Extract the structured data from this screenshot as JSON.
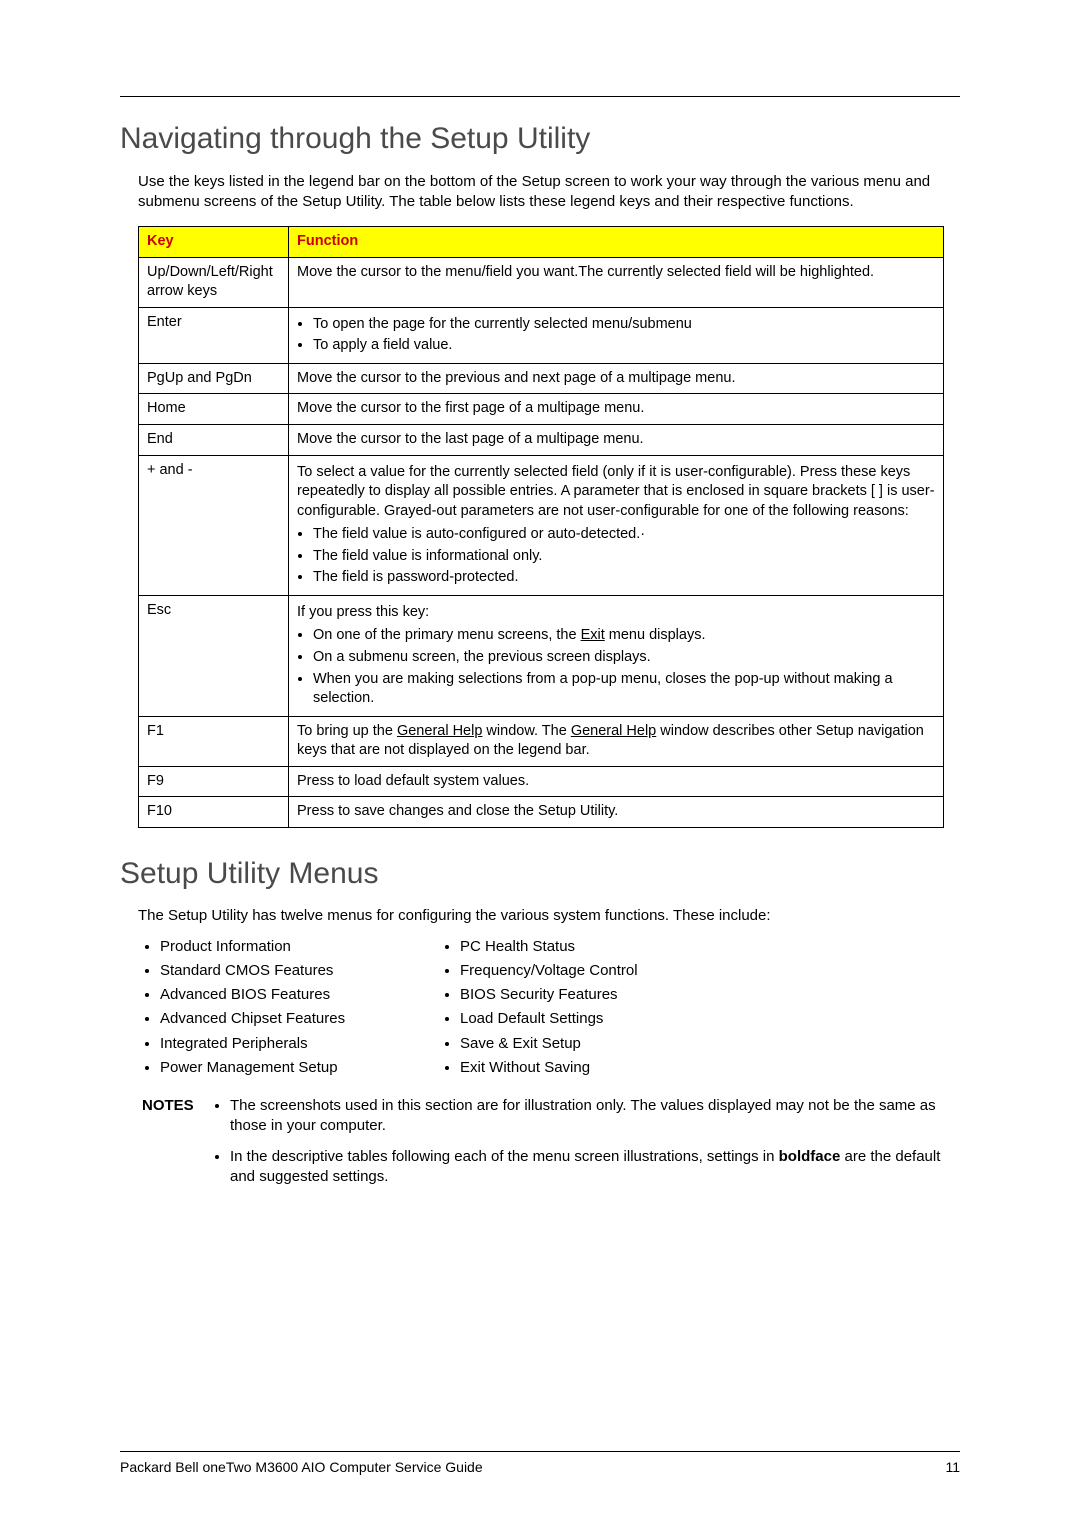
{
  "heading1": "Navigating through the Setup Utility",
  "intro1": "Use the keys listed in the legend bar on the bottom of the Setup screen to work your way through the various menu and submenu screens of the Setup Utility. The table below lists these legend keys and their respective functions.",
  "table": {
    "headers": [
      "Key",
      "Function"
    ],
    "rows": [
      {
        "key": "Up/Down/Left/Right arrow keys",
        "func_text": "Move the cursor to the menu/field you want.The currently selected field will be highlighted."
      },
      {
        "key": "Enter",
        "func_list": [
          "To open the page for the currently selected menu/submenu",
          "To apply a field value."
        ]
      },
      {
        "key": "PgUp and PgDn",
        "func_text": "Move the cursor to the previous and next page of a multipage menu."
      },
      {
        "key": "Home",
        "func_text": "Move the cursor to the first page of a multipage menu."
      },
      {
        "key": "End",
        "func_text": "Move the cursor to the last page of a multipage menu."
      },
      {
        "key": "+ and -",
        "func_para": "To select a value for the currently selected field (only if it is user-configurable). Press these keys repeatedly to display all possible entries. A parameter that is enclosed in square brackets [ ] is user-configurable. Grayed-out parameters are not user-configurable for one of the following reasons:",
        "func_list": [
          "The field value is auto-configured or auto-detected.·",
          "The field value is informational only.",
          "The field is password-protected."
        ]
      },
      {
        "key": "Esc",
        "func_intro": "If you press this key:",
        "esc1a": "On one of the primary menu screens, the ",
        "esc1b": "Exit",
        "esc1c": " menu displays.",
        "esc2": "On a submenu screen, the previous screen displays.",
        "esc3": "When you are making selections from a pop-up menu, closes the pop-up without making a selection."
      },
      {
        "key": "F1",
        "f1a": "To bring up the ",
        "f1b": "General Help",
        "f1c": " window. The ",
        "f1d": "General Help",
        "f1e": " window describes other Setup navigation keys that are not displayed on the legend bar."
      },
      {
        "key": "F9",
        "func_text": "Press to load default system values."
      },
      {
        "key": "F10",
        "func_text": "Press to save changes and close the Setup Utility."
      }
    ]
  },
  "heading2": "Setup Utility Menus",
  "menus_intro": "The Setup Utility has twelve menus for configuring the various system functions. These include:",
  "menus_left": [
    "Product Information",
    "Standard CMOS Features",
    "Advanced BIOS Features",
    "Advanced Chipset Features",
    "Integrated Peripherals",
    "Power Management Setup"
  ],
  "menus_right": [
    "PC Health Status",
    "Frequency/Voltage Control",
    "BIOS Security Features",
    "Load Default Settings",
    "Save & Exit Setup",
    "Exit Without Saving"
  ],
  "notes_label": "NOTES",
  "note1": "The screenshots used in this section are for illustration only. The values displayed may not be the same as those in your computer.",
  "note2a": "In the descriptive tables following each of the menu screen illustrations, settings in ",
  "note2b": "boldface",
  "note2c": " are the default and suggested settings.",
  "footer_left": "Packard Bell oneTwo M3600 AIO Computer Service Guide",
  "footer_right": "11"
}
